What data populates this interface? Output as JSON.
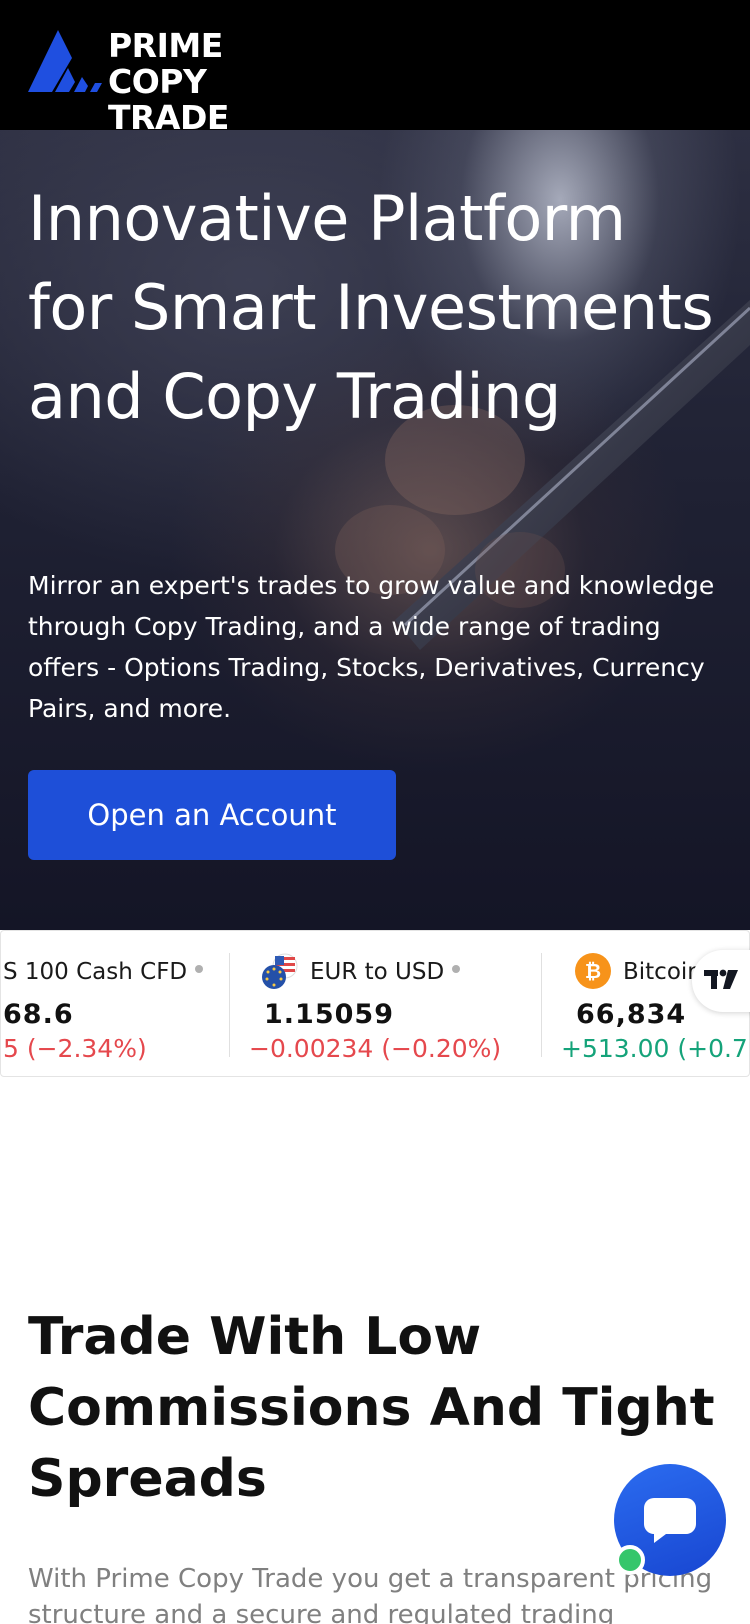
{
  "header": {
    "logo_line1": "PRIME",
    "logo_line2": "COPY TRADE",
    "logo_icon": "stacked-chevron-logo-icon"
  },
  "hero": {
    "title": "Innovative Platform for Smart Investments and Copy Trading",
    "subtitle": "Mirror an expert's trades to grow value and knowledge through Copy Trading, and a wide range of trading offers - Options Trading, Stocks, Derivatives, Currency Pairs, and more.",
    "cta_label": "Open an Account"
  },
  "ticker": {
    "items": [
      {
        "name": "S 100 Cash CFD",
        "price": "68.6",
        "change": "5 (−2.34%)",
        "direction": "down"
      },
      {
        "name": "EUR to USD",
        "price": "1.15059",
        "change": "−0.00234 (−0.20%)",
        "direction": "down",
        "icon": "eu-us-flag-icon"
      },
      {
        "name": "Bitcoir",
        "price": "66,834",
        "change": "+513.00 (+0.7",
        "direction": "up",
        "icon": "bitcoin-icon"
      }
    ],
    "badge_icon": "tradingview-logo-icon"
  },
  "section": {
    "title": "Trade With Low Commissions And Tight Spreads",
    "text": "With Prime Copy Trade you get a transparent pricing structure and a secure and regulated trading"
  },
  "chat": {
    "icon": "chat-bubble-icon",
    "status": "online"
  },
  "colors": {
    "header_bg": "#000000",
    "accent_blue": "#1e4fd8",
    "negative": "#e5484d",
    "positive": "#15a37a",
    "online": "#35c66b"
  }
}
